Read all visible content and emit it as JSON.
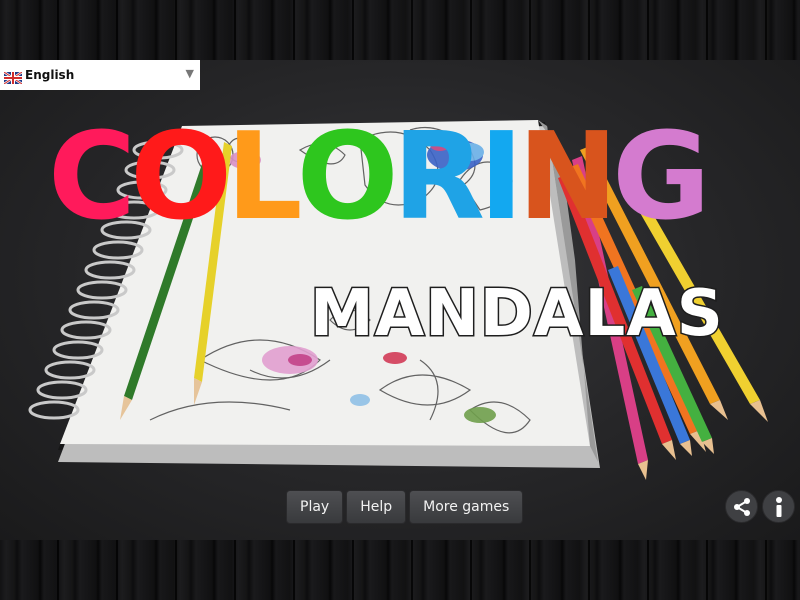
{
  "language": {
    "selected": "English",
    "flag_icon": "uk-flag-icon"
  },
  "title": {
    "letters": [
      {
        "char": "C",
        "color": "#ff1a5b"
      },
      {
        "char": "O",
        "color": "#ff1a1a"
      },
      {
        "char": "L",
        "color": "#ff9a1a"
      },
      {
        "char": "O",
        "color": "#2ec61e"
      },
      {
        "char": "R",
        "color": "#1fa3e6"
      },
      {
        "char": "I",
        "color": "#13a8f0"
      },
      {
        "char": "N",
        "color": "#d8541d"
      },
      {
        "char": "G",
        "color": "#d47bcf"
      }
    ],
    "subtitle": "MANDALAS"
  },
  "menu": {
    "play": "Play",
    "help": "Help",
    "more_games": "More games"
  },
  "icons": {
    "share": "share-icon",
    "info": "info-icon"
  }
}
